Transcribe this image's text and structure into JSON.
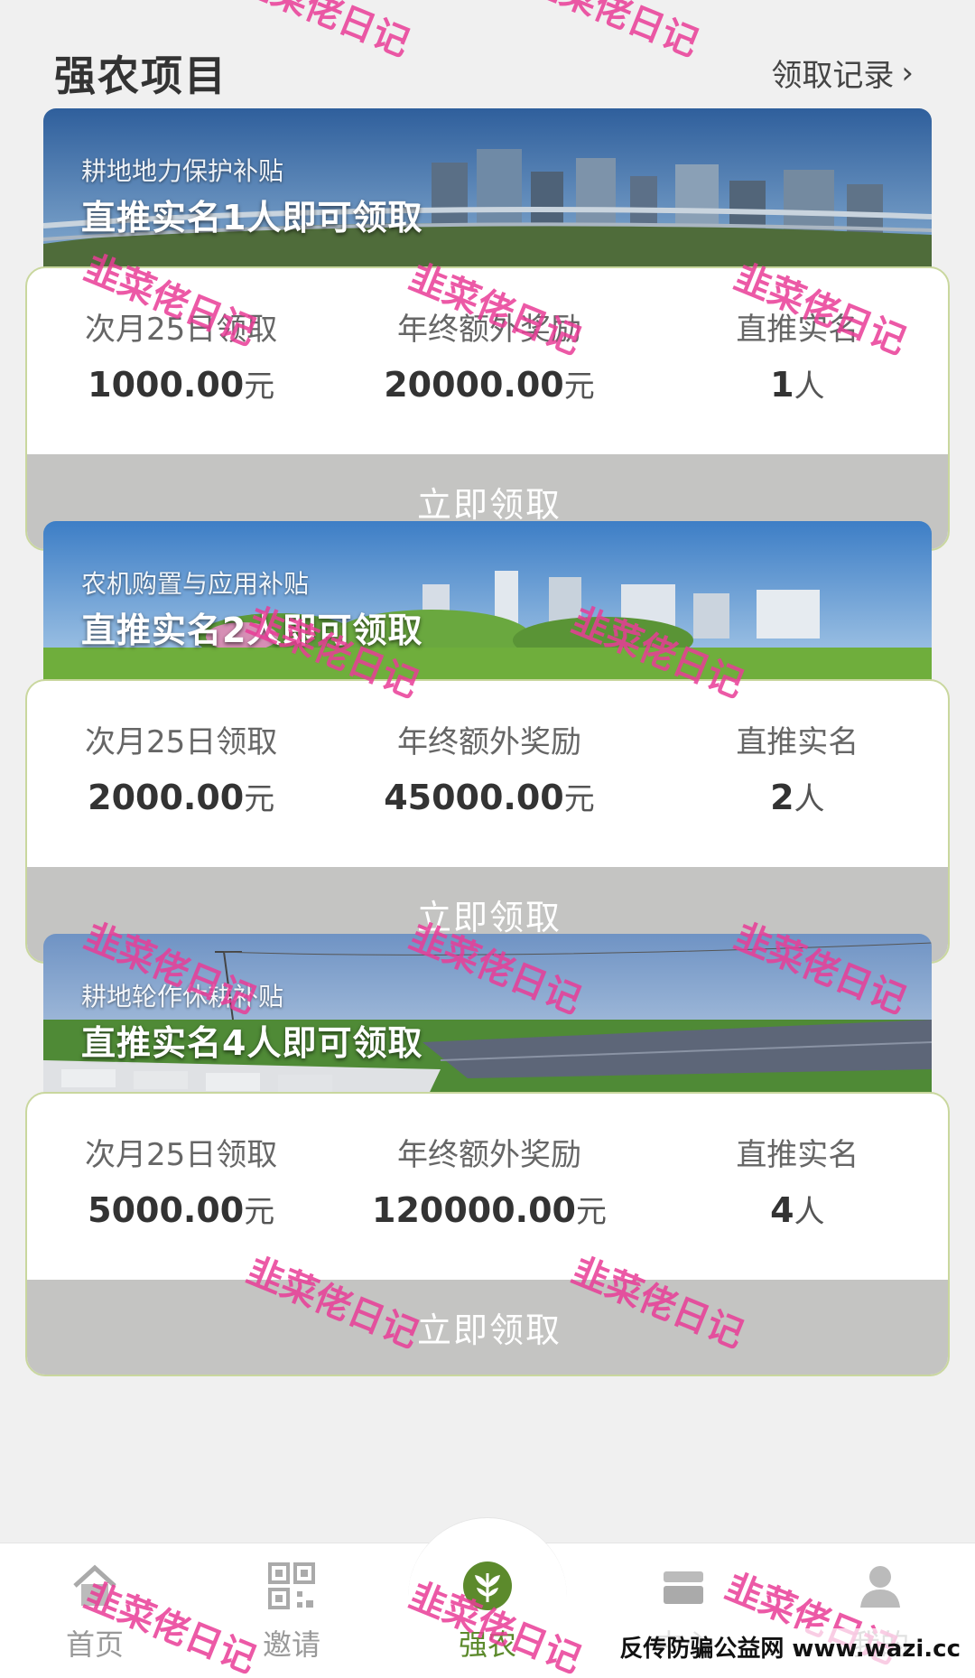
{
  "header": {
    "title": "强农项目",
    "records_link": "领取记录"
  },
  "projects": [
    {
      "banner_subtitle": "耕地地力保护补贴",
      "banner_title": "直推实名1人即可领取",
      "stats": [
        {
          "label": "次月25日领取",
          "value": "1000.00",
          "unit": "元"
        },
        {
          "label": "年终额外奖励",
          "value": "20000.00",
          "unit": "元"
        },
        {
          "label": "直推实名",
          "value": "1",
          "unit": "人"
        }
      ],
      "button": "立即领取"
    },
    {
      "banner_subtitle": "农机购置与应用补贴",
      "banner_title": "直推实名2人即可领取",
      "stats": [
        {
          "label": "次月25日领取",
          "value": "2000.00",
          "unit": "元"
        },
        {
          "label": "年终额外奖励",
          "value": "45000.00",
          "unit": "元"
        },
        {
          "label": "直推实名",
          "value": "2",
          "unit": "人"
        }
      ],
      "button": "立即领取"
    },
    {
      "banner_subtitle": "耕地轮作休耕补贴",
      "banner_title": "直推实名4人即可领取",
      "stats": [
        {
          "label": "次月25日领取",
          "value": "5000.00",
          "unit": "元"
        },
        {
          "label": "年终额外奖励",
          "value": "120000.00",
          "unit": "元"
        },
        {
          "label": "直推实名",
          "value": "4",
          "unit": "人"
        }
      ],
      "button": "立即领取"
    }
  ],
  "tabbar": {
    "items": [
      {
        "label": "首页",
        "icon": "home-icon"
      },
      {
        "label": "邀请",
        "icon": "qr-code-icon"
      },
      {
        "label": "强农",
        "icon": "leaf-icon",
        "active": true
      },
      {
        "label": "中心",
        "icon": "stack-icon"
      },
      {
        "label": "我的",
        "icon": "user-icon"
      }
    ]
  },
  "watermark": {
    "text": "韭菜佬日记",
    "corner": "反传防骗公益网 www.wazi.cc"
  },
  "colors": {
    "accent": "#5c8a2c",
    "card_border": "#c9d79e",
    "button_bg": "#c4c4c2",
    "watermark": "#e93c96"
  }
}
